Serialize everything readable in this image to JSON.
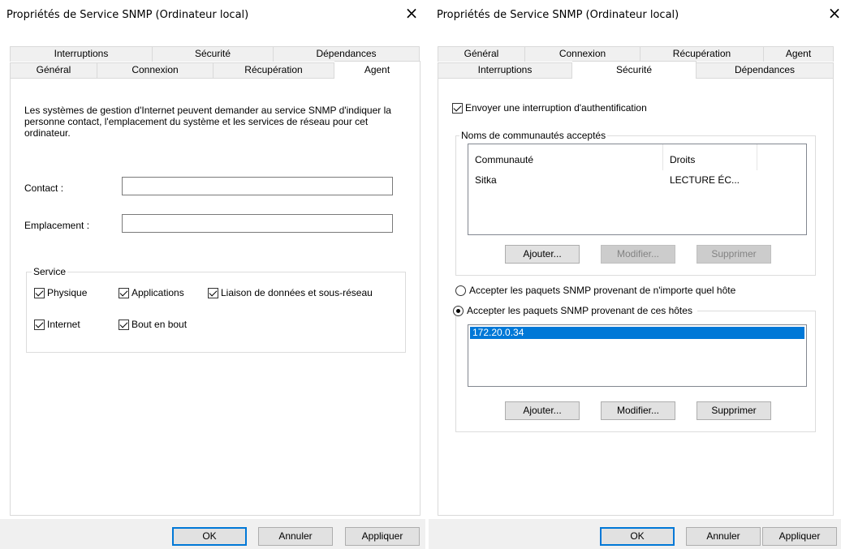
{
  "left": {
    "title": "Propriétés de Service SNMP (Ordinateur local)",
    "close": "×",
    "tabs_top": [
      "Interruptions",
      "Sécurité",
      "Dépendances"
    ],
    "tabs_bottom": [
      "Général",
      "Connexion",
      "Récupération",
      "Agent"
    ],
    "description": "Les systèmes de gestion d'Internet peuvent demander au service SNMP d'indiquer la personne contact, l'emplacement du système et les services de réseau pour cet ordinateur.",
    "contact_label": "Contact :",
    "contact_value": "",
    "location_label": "Emplacement :",
    "location_value": "",
    "service_group": "Service",
    "services": {
      "physique": {
        "label": "Physique",
        "checked": true
      },
      "applications": {
        "label": "Applications",
        "checked": true
      },
      "liaison": {
        "label": "Liaison de données et sous-réseau",
        "checked": true
      },
      "internet": {
        "label": "Internet",
        "checked": true
      },
      "bout": {
        "label": "Bout en bout",
        "checked": true
      }
    },
    "ok": "OK",
    "cancel": "Annuler",
    "apply": "Appliquer"
  },
  "right": {
    "title": "Propriétés de Service SNMP (Ordinateur local)",
    "close": "×",
    "tabs_top": [
      "Général",
      "Connexion",
      "Récupération",
      "Agent"
    ],
    "tabs_bottom": [
      "Interruptions",
      "Sécurité",
      "Dépendances"
    ],
    "auth_trap": {
      "label": "Envoyer une interruption d'authentification",
      "checked": true
    },
    "communities_group": "Noms de communautés acceptés",
    "communities_columns": [
      "Communauté",
      "Droits"
    ],
    "communities_rows": [
      {
        "name": "Sitka",
        "rights": "LECTURE ÉC..."
      }
    ],
    "comm_add": "Ajouter...",
    "comm_edit": "Modifier...",
    "comm_remove": "Supprimer",
    "radio_any": {
      "label": "Accepter les paquets SNMP provenant de n'importe quel hôte",
      "checked": false
    },
    "radio_these": {
      "label": "Accepter les paquets SNMP provenant de ces hôtes",
      "checked": true
    },
    "hosts": [
      "172.20.0.34"
    ],
    "host_add": "Ajouter...",
    "host_edit": "Modifier...",
    "host_remove": "Supprimer",
    "ok": "OK",
    "cancel": "Annuler",
    "apply": "Appliquer"
  }
}
